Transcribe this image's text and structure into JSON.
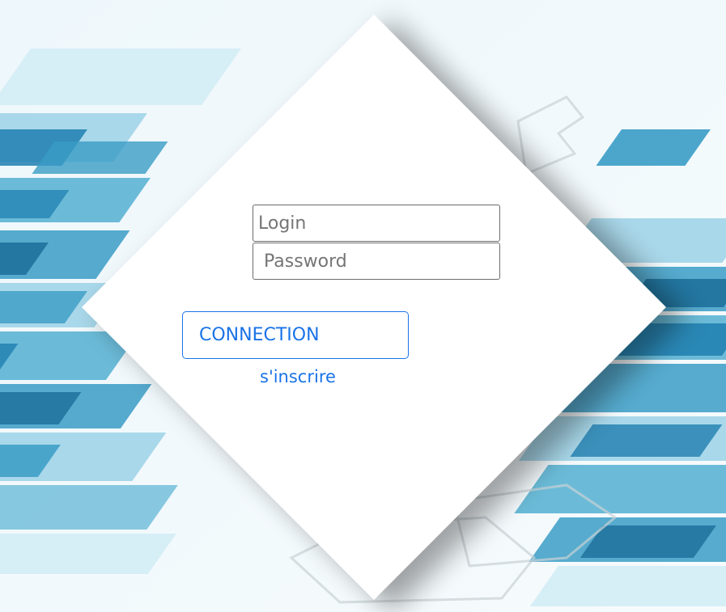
{
  "login_form": {
    "login_placeholder": "Login",
    "password_placeholder": "Password",
    "connect_label": "CONNECTION",
    "signup_label": "s'inscrire"
  },
  "theme": {
    "accent": "#1a73e8",
    "card": "#ffffff",
    "tile_colors": [
      "#1f7fb0",
      "#3a9cc6",
      "#6bbbd8",
      "#a9d8ea",
      "#d6eef6"
    ]
  }
}
